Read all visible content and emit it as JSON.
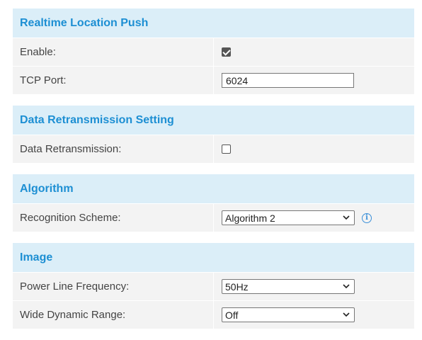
{
  "sections": [
    {
      "title": "Realtime Location Push",
      "rows": [
        {
          "label": "Enable:",
          "type": "checkbox",
          "checked": true
        },
        {
          "label": "TCP Port:",
          "type": "text",
          "value": "6024"
        }
      ]
    },
    {
      "title": "Data Retransmission Setting",
      "rows": [
        {
          "label": "Data Retransmission:",
          "type": "checkbox",
          "checked": false
        }
      ]
    },
    {
      "title": "Algorithm",
      "rows": [
        {
          "label": "Recognition Scheme:",
          "type": "select",
          "value": "Algorithm 2",
          "info_icon": "info-icon"
        }
      ]
    },
    {
      "title": "Image",
      "rows": [
        {
          "label": "Power Line Frequency:",
          "type": "select",
          "value": "50Hz"
        },
        {
          "label": "Wide Dynamic Range:",
          "type": "select",
          "value": "Off"
        }
      ]
    }
  ],
  "colors": {
    "header_bg": "#dbeef8",
    "header_text": "#1d8fd3",
    "row_bg": "#f3f3f3",
    "info": "#3a8fd8"
  }
}
